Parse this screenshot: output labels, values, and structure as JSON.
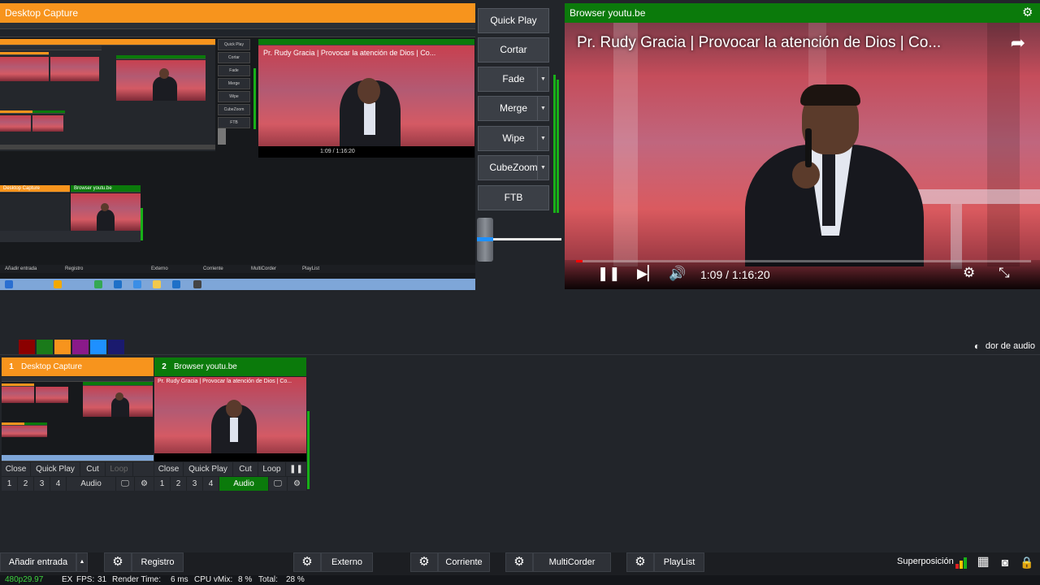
{
  "preview": {
    "title": "Desktop Capture",
    "nested_transitions": [
      "Quick Play",
      "Cortar",
      "Fade",
      "Merge",
      "Wipe",
      "CubeZoom",
      "FTB"
    ],
    "nested_video_title": "Pr. Rudy Gracia | Provocar la atención de Dios | Co...",
    "nested_time": "1:09 / 1:16:20",
    "nested_input1": "Desktop Capture",
    "nested_input2": "Browser youtu.be",
    "nested_bottom": [
      "Añadir entrada",
      "Registro",
      "Externo",
      "Corriente",
      "MultiCorder",
      "PlayList"
    ]
  },
  "transitions": {
    "quick_play": "Quick Play",
    "cortar": "Cortar",
    "fade": "Fade",
    "merge": "Merge",
    "wipe": "Wipe",
    "cubezoom": "CubeZoom",
    "ftb": "FTB"
  },
  "output": {
    "title": "Browser youtu.be",
    "video_title": "Pr. Rudy Gracia | Provocar la atención de Dios | Co...",
    "time": "1:09 / 1:16:20",
    "progress_fraction": 0.015
  },
  "color_tabs": [
    "#22252a",
    "#8b0000",
    "#1a7a1a",
    "#f7941d",
    "#8a1a8a",
    "#1e90ff",
    "#1a1a6e"
  ],
  "mixer_label": "dor de audio",
  "inputs": [
    {
      "number": "1",
      "title": "Desktop Capture",
      "color": "#f7941d",
      "row1": [
        "Close",
        "Quick Play",
        "Cut",
        "Loop"
      ],
      "row2": [
        "1",
        "2",
        "3",
        "4"
      ],
      "audio": "Audio"
    },
    {
      "number": "2",
      "title": "Browser youtu.be",
      "color": "#0b7a0b",
      "row1": [
        "Close",
        "Quick Play",
        "Cut",
        "Loop"
      ],
      "row2": [
        "1",
        "2",
        "3",
        "4"
      ],
      "audio": "Audio",
      "thumb_video_title": "Pr. Rudy Gracia | Provocar la atención de Dios | Co..."
    }
  ],
  "bottom": {
    "add_input": "Añadir entrada",
    "registro": "Registro",
    "externo": "Externo",
    "corriente": "Corriente",
    "multicorder": "MultiCorder",
    "playlist": "PlayList",
    "superposicion": "Superposición"
  },
  "status": {
    "resolution": "480p29.97",
    "ex": "EX",
    "fps_label": "FPS:",
    "fps": "31",
    "render_label": "Render Time:",
    "render": "6 ms",
    "cpu_label": "CPU vMix:",
    "cpu": "8 %",
    "total_label": "Total:",
    "total": "28 %"
  },
  "colors": {
    "preview": "#f7941d",
    "output": "#0b7a0b",
    "accent_blue": "#1e90ff",
    "meter": "#18b018"
  }
}
